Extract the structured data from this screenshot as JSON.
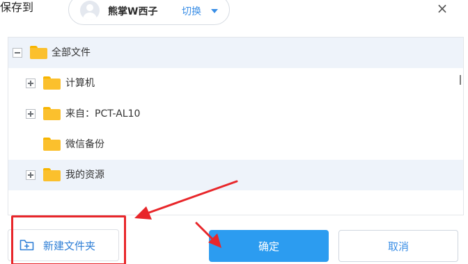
{
  "dialog": {
    "title": "保存到",
    "close_glyph": "×"
  },
  "account": {
    "username": "熊掌W西子",
    "switch_label": "切换"
  },
  "tree": {
    "root": {
      "label": "全部文件",
      "expanded": true,
      "selected": true
    },
    "children": [
      {
        "label": "计算机",
        "has_toggle": true
      },
      {
        "label": "来自：PCT-AL10",
        "has_toggle": true
      },
      {
        "label": "微信备份",
        "has_toggle": false
      },
      {
        "label": "我的资源",
        "has_toggle": true,
        "selected": true
      }
    ]
  },
  "footer": {
    "new_folder_label": "新建文件夹",
    "confirm_label": "确定",
    "cancel_label": "取消"
  },
  "annotation": {
    "box_target": "new-folder-button",
    "arrow_targets": [
      "new-folder-button",
      "confirm-button"
    ]
  },
  "colors": {
    "accent": "#3a8ee6",
    "primary_button": "#2c9cf0",
    "folder": "#fbc02d",
    "selected_row": "#eef3fa",
    "annotation_red": "#e8262a"
  },
  "icons": [
    "avatar-icon",
    "caret-down-icon",
    "close-icon",
    "collapse-icon",
    "expand-icon",
    "folder-icon",
    "new-folder-icon"
  ]
}
